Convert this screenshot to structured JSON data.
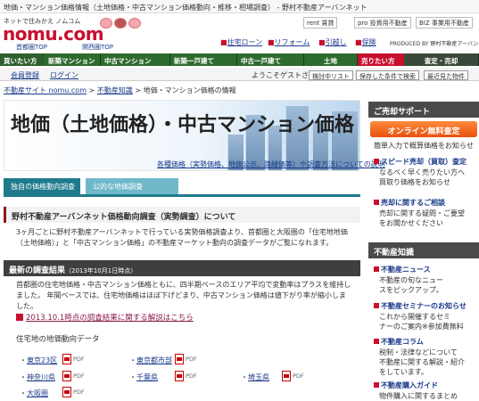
{
  "window": {
    "title": "地価・マンション価格情報（土地価格・中古マンション価格動向・推移・相場調査） - 野村不動産アーバンネット"
  },
  "header": {
    "tagline": "ネットで住みかえ ノムコム",
    "logo_text": "nomu.com",
    "sub_links": [
      "首都圏TOP",
      "関西圏TOP"
    ],
    "top_buttons": [
      "rent 賃貸",
      "pro 投資用不動産",
      "BIZ 事業用不動産"
    ],
    "util_links": [
      "住宅ローン",
      "リフォーム",
      "引越し",
      "保険"
    ],
    "produced_by": "PRODUCED BY 野村不動産アーバンネット"
  },
  "nav": {
    "items": [
      "買いたい方",
      "新築マンション",
      "中古マンション",
      "新築一戸建て",
      "中古一戸建て",
      "土地",
      "売りたい方",
      "査定・売却"
    ]
  },
  "subbar": {
    "register": "会員登録",
    "login": "ログイン",
    "welcome": "ようこそゲストさま。",
    "buttons": [
      "検討中リスト",
      "保存した条件で検索",
      "最近見た物件"
    ]
  },
  "breadcrumb": [
    "不動産サイト nomu.com",
    "不動産知識",
    "地価・マンション価格の情報"
  ],
  "hero": {
    "title": "地価（土地価格）・中古マンション価格",
    "link_text": "各種価格（実勢価格、地価公示、路線価等）や調査方法についての説明"
  },
  "tabs": [
    "独自の価格動向調査",
    "公的な地価調査"
  ],
  "section1": {
    "heading": "野村不動産アーバンネット価格動向調査（実勢調査）について",
    "lines": [
      "3ヶ月ごとに野村不動産アーバンネットで行っている実勢価格調査より、首都圏と大阪圏の「住宅地地価",
      "（土地価格）」と「中古マンション価格」の不動産マーケット動向の調査データがご覧になれます。"
    ]
  },
  "section2": {
    "heading": "最新の調査結果",
    "date": "（2013年10月1日時点）",
    "lines": [
      "首都圏の住宅地価格・中古マンション価格ともに、四半期ベースのエリア平均で変動率はプラスを維持し",
      "ました。 年間ベースでは、住宅地価格はほぼ下げどまり、中古マンション価格は値下がり率が縮小しま",
      "した。"
    ],
    "link": "2013.10.1時点の調査結果に関する解説はこちら",
    "subheading": "住宅地の地価動向データ",
    "areas": [
      "東京23区",
      "東京都市部",
      "神奈川県",
      "千葉県",
      "埼玉県",
      "大阪圏"
    ],
    "pdf_label": "PDF"
  },
  "sidebar": {
    "support_heading": "ご売却サポート",
    "online_button": "オンライン無料査定",
    "online_desc": "簡単入力で概算価格をお知らせ",
    "speed_title": "スピード売却（買取）査定",
    "speed_desc": [
      "なるべく早く売りたい方へ",
      "買取り価格をお知らせ"
    ],
    "consult_title": "売却に関するご相談",
    "consult_desc": [
      "売却に関する疑問・ご要望",
      "をお聞かせください"
    ],
    "knowledge_heading": "不動産知識",
    "knowledge_items": [
      {
        "title": "不動産ニュース",
        "desc": [
          "不動産の旬なニュー",
          "スをピックアップ。"
        ]
      },
      {
        "title": "不動産セミナーのお知らせ",
        "desc": [
          "これから開催するセミ",
          "ナーのご案内※参加費無料"
        ]
      },
      {
        "title": "不動産コラム",
        "desc": [
          "税制・法律などについて",
          "不動産に関する解説・紹介",
          "をしています。"
        ]
      },
      {
        "title": "不動産購入ガイド",
        "desc": [
          "物件購入に関するまとめ"
        ]
      }
    ]
  },
  "colors": {
    "brand_red": "#c8102e",
    "nav_green": "#2e6b2e",
    "tab_teal": "#1f7a8c",
    "link_blue": "#1a3a8a",
    "orange": "#e8510c"
  },
  "icons": [
    "pig-icon",
    "pdf-icon",
    "arrow-square-icon",
    "key-icon",
    "house-icon"
  ]
}
